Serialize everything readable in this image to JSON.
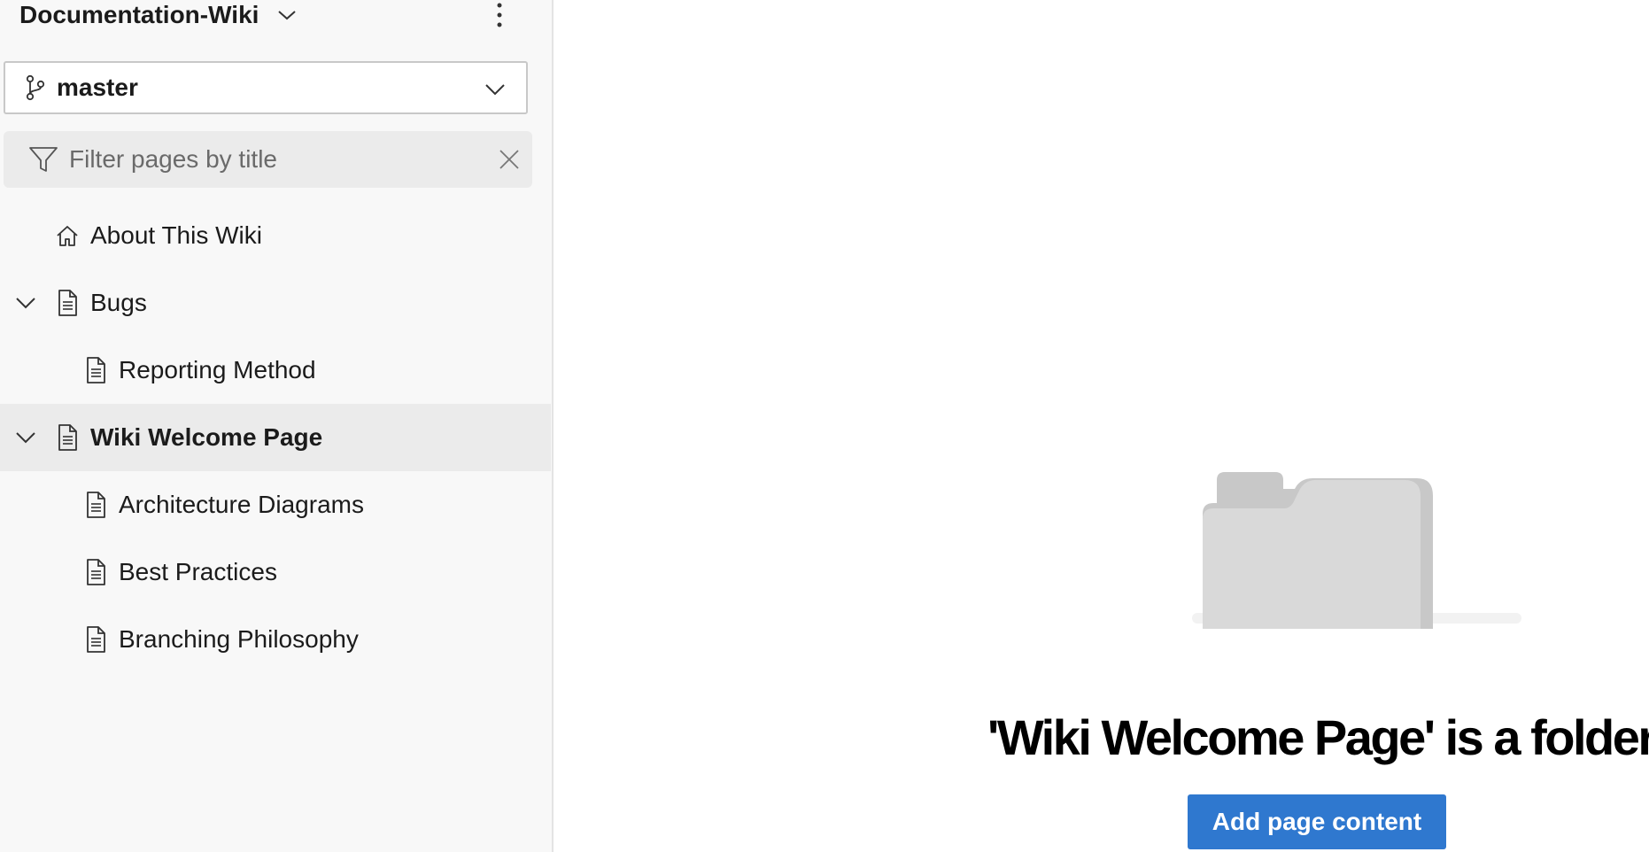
{
  "sidebar": {
    "wiki_title": "Documentation-Wiki",
    "branch": {
      "name": "master"
    },
    "filter": {
      "placeholder": "Filter pages by title",
      "value": ""
    },
    "tree": [
      {
        "label": "About This Wiki",
        "icon": "home-icon",
        "level": 0,
        "expandable": false,
        "selected": false
      },
      {
        "label": "Bugs",
        "icon": "page-icon",
        "level": 0,
        "expandable": true,
        "expanded": true,
        "selected": false
      },
      {
        "label": "Reporting Method",
        "icon": "page-icon",
        "level": 1,
        "expandable": false,
        "selected": false
      },
      {
        "label": "Wiki Welcome Page",
        "icon": "page-icon",
        "level": 0,
        "expandable": true,
        "expanded": true,
        "selected": true
      },
      {
        "label": "Architecture Diagrams",
        "icon": "page-icon",
        "level": 1,
        "expandable": false,
        "selected": false
      },
      {
        "label": "Best Practices",
        "icon": "page-icon",
        "level": 1,
        "expandable": false,
        "selected": false
      },
      {
        "label": "Branching Philosophy",
        "icon": "page-icon",
        "level": 1,
        "expandable": false,
        "selected": false
      }
    ]
  },
  "main": {
    "empty_state": {
      "illustration": "folder-illustration",
      "title": "'Wiki Welcome Page' is a folder",
      "action_label": "Add page content"
    }
  },
  "colors": {
    "accent": "#2f78cf",
    "sidebar_bg": "#f8f8f8",
    "selected_row_bg": "#ebebeb"
  }
}
